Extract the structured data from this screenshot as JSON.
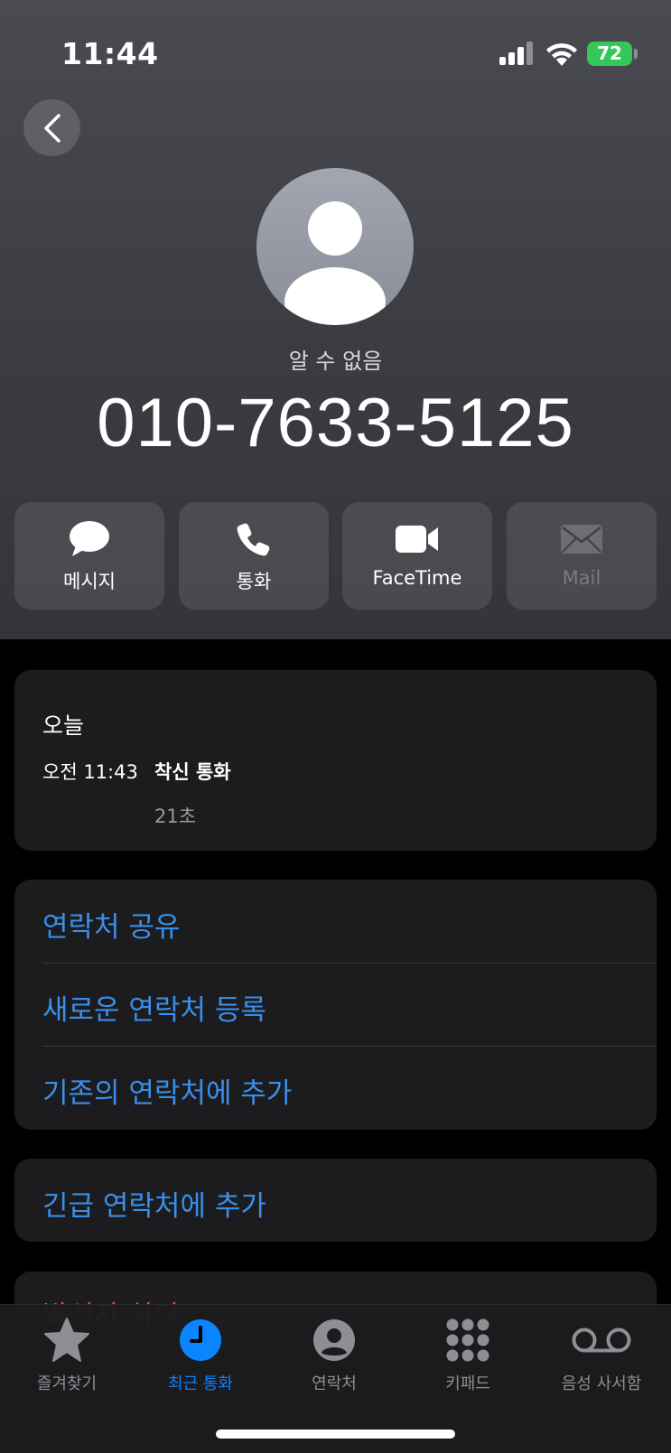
{
  "status": {
    "time": "11:44",
    "battery": "72"
  },
  "contact": {
    "label": "알 수 없음",
    "number": "010-7633-5125"
  },
  "actions": [
    {
      "label": "메시지",
      "icon": "message-icon",
      "enabled": true
    },
    {
      "label": "통화",
      "icon": "phone-icon",
      "enabled": true
    },
    {
      "label": "FaceTime",
      "icon": "video-icon",
      "enabled": true
    },
    {
      "label": "Mail",
      "icon": "mail-icon",
      "enabled": false
    }
  ],
  "history": {
    "title": "오늘",
    "time": "오전 11:43",
    "type": "착신 통화",
    "duration": "21초"
  },
  "options": {
    "share": "연락처 공유",
    "new_contact": "새로운 연락처 등록",
    "add_existing": "기존의 연락처에 추가",
    "emergency": "긴급 연락처에 추가",
    "block": "발신자 차단"
  },
  "tabs": [
    {
      "label": "즐겨찾기",
      "icon": "star-icon",
      "active": false
    },
    {
      "label": "최근 통화",
      "icon": "clock-icon",
      "active": true
    },
    {
      "label": "연락처",
      "icon": "person-circle-icon",
      "active": false
    },
    {
      "label": "키패드",
      "icon": "keypad-icon",
      "active": false
    },
    {
      "label": "음성 사서함",
      "icon": "voicemail-icon",
      "active": false
    }
  ],
  "colors": {
    "accent": "#0a84ff",
    "link": "#3a8eea",
    "destructive": "#eb4b3d",
    "battery": "#34c759"
  }
}
